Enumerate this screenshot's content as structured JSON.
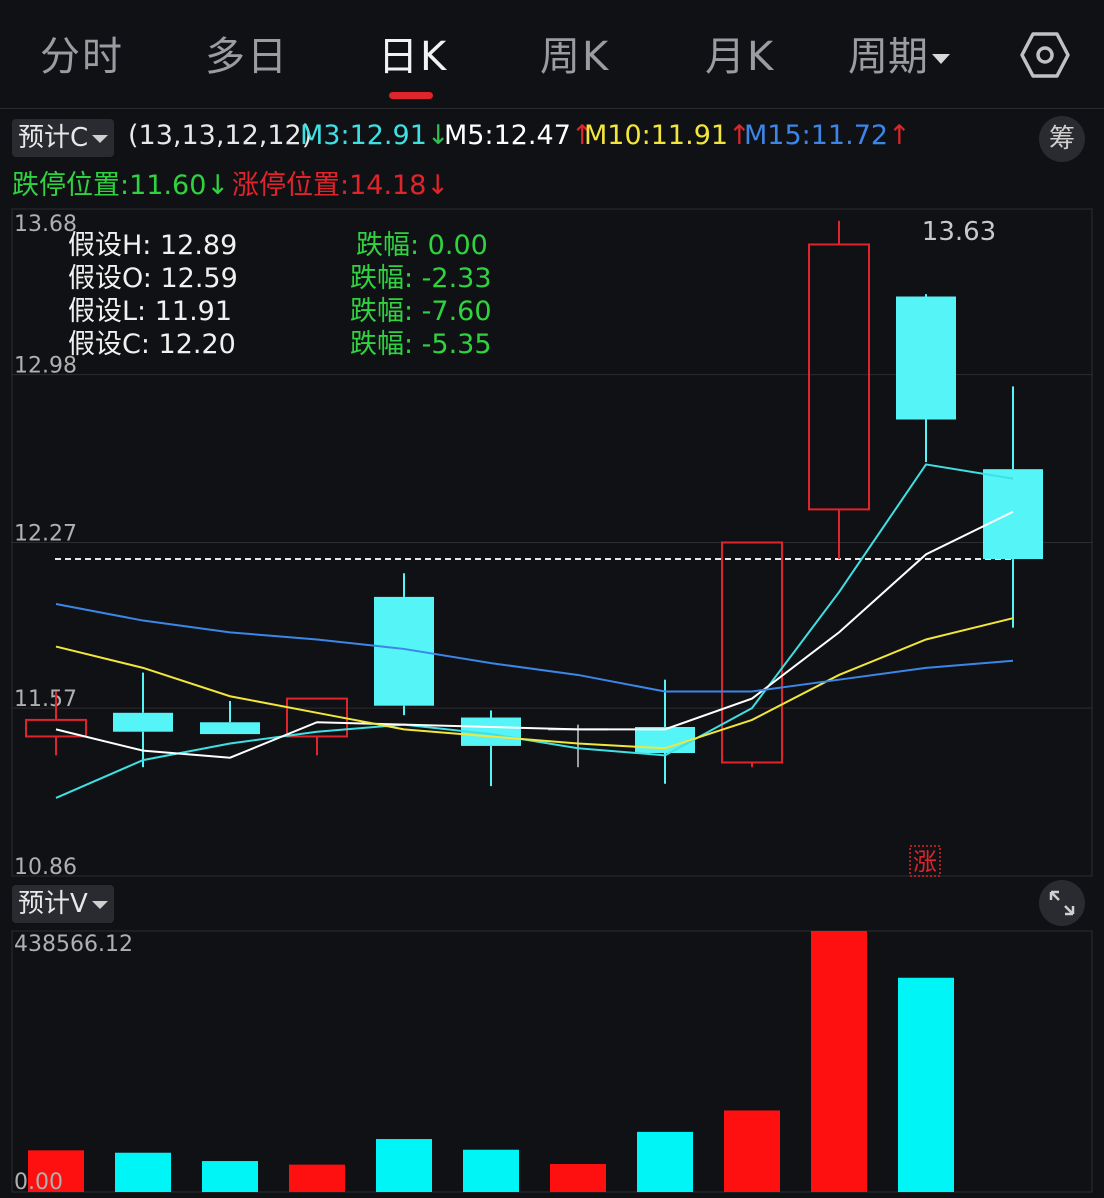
{
  "tabs": {
    "items": [
      "分时",
      "多日",
      "日K",
      "周K",
      "月K",
      "周期"
    ],
    "active": "日K"
  },
  "indicator": {
    "main_selector": "预计C",
    "params": "(13,13,12,12)",
    "ma": [
      {
        "label": "M3:12.91",
        "arrow": "↓",
        "color": "#3fe0e3",
        "arrow_color": "#2fbf4f"
      },
      {
        "label": "M5:12.47",
        "arrow": "↑",
        "color": "#ffffff",
        "arrow_color": "#e0242b"
      },
      {
        "label": "M10:11.91",
        "arrow": "↑",
        "color": "#f3e63b",
        "arrow_color": "#e0242b"
      },
      {
        "label": "M15:11.72",
        "arrow": "↑",
        "color": "#3b86e8",
        "arrow_color": "#e0242b"
      }
    ],
    "chip_button": "筹",
    "limit_down": {
      "label": "跌停位置:11.60",
      "arrow": "↓",
      "color": "#2fd33f"
    },
    "limit_up": {
      "label": "涨停位置:14.18",
      "arrow": "↓",
      "color": "#e0242b"
    }
  },
  "hypothesis": {
    "rows": [
      {
        "label": "假设H: 12.89",
        "change": "跌幅: 0.00"
      },
      {
        "label": "假设O: 12.59",
        "change": "跌幅: -2.33"
      },
      {
        "label": "假设L: 11.91",
        "change": "跌幅: -7.60"
      },
      {
        "label": "假设C: 12.20",
        "change": "跌幅: -5.35"
      }
    ]
  },
  "volume_selector": "预计V",
  "limit_up_tag": "涨",
  "colors": {
    "up": "#e0242b",
    "down": "#55f4f6",
    "m3": "#3fe0e3",
    "m5": "#ffffff",
    "m10": "#f3e63b",
    "m15": "#3b86e8",
    "grid": "#2c2d31",
    "axis": "#b0b0b0"
  },
  "chart_data": {
    "type": "candlestick",
    "price_axis": {
      "ticks": [
        "13.68",
        "12.98",
        "12.27",
        "11.57",
        "10.86"
      ],
      "ylim": [
        10.86,
        13.68
      ]
    },
    "max_price_label": "13.63",
    "reference_line": 12.2,
    "candles": [
      {
        "open": 11.45,
        "high": 11.64,
        "low": 11.37,
        "close": 11.52,
        "dir": "up"
      },
      {
        "open": 11.55,
        "high": 11.72,
        "low": 11.32,
        "close": 11.47,
        "dir": "down"
      },
      {
        "open": 11.51,
        "high": 11.6,
        "low": 11.46,
        "close": 11.46,
        "dir": "down"
      },
      {
        "open": 11.45,
        "high": 11.48,
        "low": 11.37,
        "close": 11.61,
        "dir": "up"
      },
      {
        "open": 12.04,
        "high": 12.14,
        "low": 11.54,
        "close": 11.58,
        "dir": "down"
      },
      {
        "open": 11.53,
        "high": 11.56,
        "low": 11.24,
        "close": 11.41,
        "dir": "down"
      },
      {
        "open": 11.48,
        "high": 11.5,
        "low": 11.32,
        "close": 11.48,
        "dir": "flat"
      },
      {
        "open": 11.49,
        "high": 11.69,
        "low": 11.25,
        "close": 11.38,
        "dir": "down"
      },
      {
        "open": 11.34,
        "high": 11.34,
        "low": 11.32,
        "close": 12.27,
        "dir": "up"
      },
      {
        "open": 12.41,
        "high": 13.63,
        "low": 12.2,
        "close": 13.53,
        "dir": "up"
      },
      {
        "open": 13.31,
        "high": 13.32,
        "low": 12.61,
        "close": 12.79,
        "dir": "down"
      },
      {
        "open": 12.58,
        "high": 12.93,
        "low": 11.91,
        "close": 12.2,
        "dir": "down"
      }
    ],
    "ma_series": [
      {
        "name": "M3",
        "values": [
          11.19,
          11.35,
          11.42,
          11.47,
          11.5,
          11.46,
          11.4,
          11.37,
          11.57,
          12.06,
          12.6,
          12.54
        ]
      },
      {
        "name": "M5",
        "values": [
          11.48,
          11.39,
          11.36,
          11.51,
          11.5,
          11.49,
          11.48,
          11.48,
          11.61,
          11.89,
          12.22,
          12.4
        ]
      },
      {
        "name": "M10",
        "values": [
          11.83,
          11.74,
          11.62,
          11.55,
          11.48,
          11.45,
          11.42,
          11.4,
          11.52,
          11.71,
          11.86,
          11.95
        ]
      },
      {
        "name": "M15",
        "values": [
          12.01,
          11.94,
          11.89,
          11.86,
          11.82,
          11.76,
          11.71,
          11.64,
          11.64,
          11.69,
          11.74,
          11.77
        ]
      }
    ],
    "volume_axis": {
      "ticks": [
        "438566.12",
        "0.00"
      ],
      "ylim": [
        0,
        438566.12
      ]
    },
    "volume": [
      {
        "value": 70000,
        "dir": "up"
      },
      {
        "value": 66000,
        "dir": "down"
      },
      {
        "value": 52000,
        "dir": "down"
      },
      {
        "value": 46000,
        "dir": "up"
      },
      {
        "value": 89000,
        "dir": "down"
      },
      {
        "value": 71000,
        "dir": "down"
      },
      {
        "value": 47000,
        "dir": "up"
      },
      {
        "value": 101000,
        "dir": "down"
      },
      {
        "value": 137000,
        "dir": "up"
      },
      {
        "value": 438566,
        "dir": "up"
      },
      {
        "value": 360000,
        "dir": "down"
      }
    ]
  }
}
